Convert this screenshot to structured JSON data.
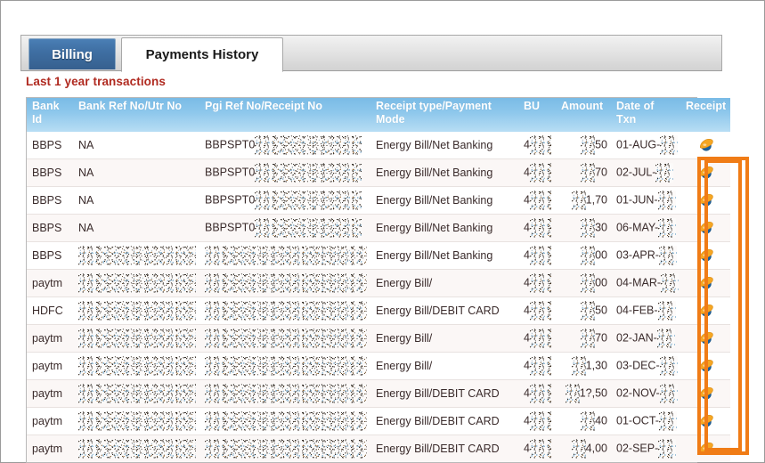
{
  "window": {
    "title": "Payments History"
  },
  "tabs": [
    {
      "id": "billing",
      "label": "Billing",
      "active": false
    },
    {
      "id": "payments-history",
      "label": "Payments History",
      "active": true
    }
  ],
  "caption": "Last 1 year transactions",
  "caption_color": "#b02a20",
  "table": {
    "columns": [
      "Bank Id",
      "Bank Ref No/Utr No",
      "Pgi Ref No/Receipt No",
      "Receipt type/Payment Mode",
      "BU",
      "Amount",
      "Date of Txn",
      "Receipt"
    ],
    "header_bg": "#8fc8ec",
    "header_text_color": "#ffffff",
    "rows": [
      {
        "bank_id": "BBPS",
        "bank_ref": "NA",
        "pgi_ref": "BBPSPT0",
        "pgi_ref_redacted": true,
        "receipt_type": "Energy Bill/Net Banking",
        "bu": "4",
        "bu_redacted": true,
        "amount": "50",
        "amount_redacted": true,
        "date": "01-AUG-",
        "date_redacted": true,
        "receipt_icon": "ie-globe-icon"
      },
      {
        "bank_id": "BBPS",
        "bank_ref": "NA",
        "pgi_ref": "BBPSPT0",
        "pgi_ref_redacted": true,
        "receipt_type": "Energy Bill/Net Banking",
        "bu": "4",
        "bu_redacted": true,
        "amount": "70",
        "amount_redacted": true,
        "date": "02-JUL-",
        "date_redacted": true,
        "receipt_icon": "ie-globe-icon"
      },
      {
        "bank_id": "BBPS",
        "bank_ref": "NA",
        "pgi_ref": "BBPSPT0",
        "pgi_ref_redacted": true,
        "receipt_type": "Energy Bill/Net Banking",
        "bu": "4",
        "bu_redacted": true,
        "amount": "1,70",
        "amount_redacted": true,
        "date": "01-JUN-",
        "date_redacted": true,
        "receipt_icon": "ie-globe-icon"
      },
      {
        "bank_id": "BBPS",
        "bank_ref": "NA",
        "pgi_ref": "BBPSPT0",
        "pgi_ref_redacted": true,
        "receipt_type": "Energy Bill/Net Banking",
        "bu": "4",
        "bu_redacted": true,
        "amount": "30",
        "amount_redacted": true,
        "date": "06-MAY-",
        "date_redacted": true,
        "receipt_icon": "ie-globe-icon"
      },
      {
        "bank_id": "BBPS",
        "bank_ref": "",
        "bank_ref_redacted": true,
        "pgi_ref": "",
        "pgi_ref_redacted": true,
        "receipt_type": "Energy Bill/Net Banking",
        "bu": "4",
        "bu_redacted": true,
        "amount": "00",
        "amount_redacted": true,
        "date": "03-APR-",
        "date_redacted": true,
        "receipt_icon": "ie-globe-icon"
      },
      {
        "bank_id": "paytm",
        "bank_ref": "",
        "bank_ref_redacted": true,
        "pgi_ref": "",
        "pgi_ref_redacted": true,
        "receipt_type": "Energy Bill/",
        "bu": "4",
        "bu_redacted": true,
        "amount": "00",
        "amount_redacted": true,
        "date": "04-MAR-",
        "date_redacted": true,
        "receipt_icon": "ie-globe-icon"
      },
      {
        "bank_id": "HDFC",
        "bank_ref": "",
        "bank_ref_redacted": true,
        "pgi_ref": "",
        "pgi_ref_redacted": true,
        "receipt_type": "Energy Bill/DEBIT CARD",
        "bu": "4",
        "bu_redacted": true,
        "amount": "50",
        "amount_redacted": true,
        "date": "04-FEB-",
        "date_redacted": true,
        "receipt_icon": "ie-globe-icon"
      },
      {
        "bank_id": "paytm",
        "bank_ref": "",
        "bank_ref_redacted": true,
        "pgi_ref": "",
        "pgi_ref_redacted": true,
        "receipt_type": "Energy Bill/",
        "bu": "4",
        "bu_redacted": true,
        "amount": "70",
        "amount_redacted": true,
        "date": "02-JAN-",
        "date_redacted": true,
        "receipt_icon": "ie-globe-icon"
      },
      {
        "bank_id": "paytm",
        "bank_ref": "",
        "bank_ref_redacted": true,
        "pgi_ref": "",
        "pgi_ref_redacted": true,
        "receipt_type": "Energy Bill/",
        "bu": "4",
        "bu_redacted": true,
        "amount": "1,30",
        "amount_redacted": true,
        "date": "03-DEC-",
        "date_redacted": true,
        "receipt_icon": "ie-globe-icon"
      },
      {
        "bank_id": "paytm",
        "bank_ref": "",
        "bank_ref_redacted": true,
        "pgi_ref": "",
        "pgi_ref_redacted": true,
        "receipt_type": "Energy Bill/DEBIT CARD",
        "bu": "4",
        "bu_redacted": true,
        "amount": "1?,50",
        "amount_redacted": true,
        "date": "02-NOV-",
        "date_redacted": true,
        "receipt_icon": "ie-globe-icon"
      },
      {
        "bank_id": "paytm",
        "bank_ref": "",
        "bank_ref_redacted": true,
        "pgi_ref": "",
        "pgi_ref_redacted": true,
        "receipt_type": "Energy Bill/DEBIT CARD",
        "bu": "4",
        "bu_redacted": true,
        "amount": "40",
        "amount_redacted": true,
        "date": "01-OCT-",
        "date_redacted": true,
        "receipt_icon": "ie-globe-icon"
      },
      {
        "bank_id": "paytm",
        "bank_ref": "",
        "bank_ref_redacted": true,
        "pgi_ref": "",
        "pgi_ref_redacted": true,
        "receipt_type": "Energy Bill/DEBIT CARD",
        "bu": "4",
        "bu_redacted": true,
        "amount": "4,00",
        "amount_redacted": true,
        "date": "02-SEP-",
        "date_redacted": true,
        "receipt_icon": "ie-globe-icon"
      }
    ]
  },
  "annotations": {
    "color": "#f07c16",
    "rects": [
      {
        "name": "receipt-column-highlight-outer"
      },
      {
        "name": "receipt-column-highlight-inner"
      }
    ]
  }
}
